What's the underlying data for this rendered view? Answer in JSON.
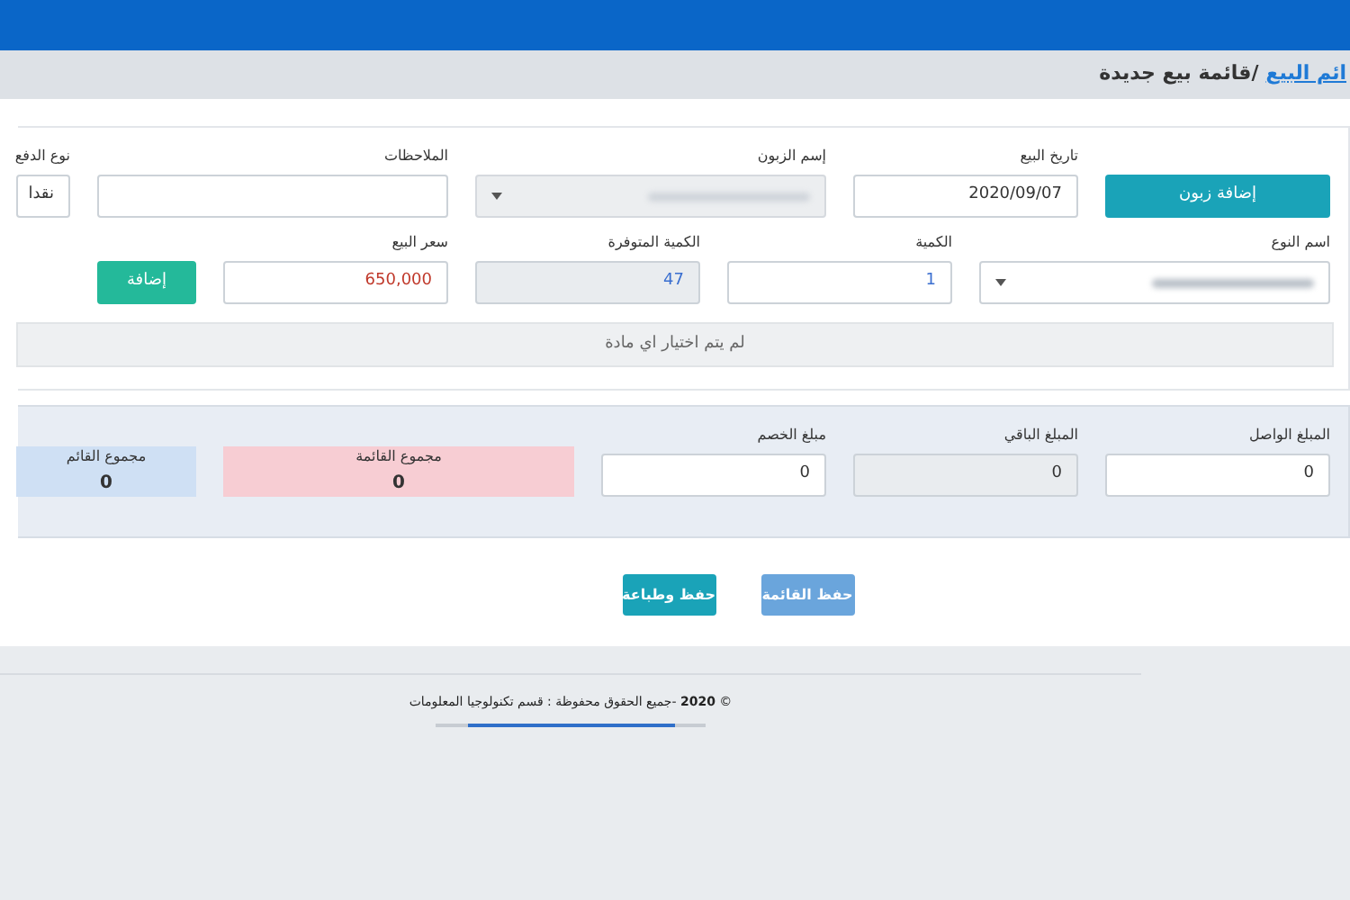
{
  "breadcrumb": {
    "link": "ائم البيع",
    "current": "/قائمة بيع جديدة"
  },
  "row_1": [
    {
      "kind": "button",
      "label": "إضافة زبون"
    },
    {
      "kind": "input",
      "label": "تاريخ البيع",
      "value": "2020/09/07"
    },
    {
      "kind": "select",
      "label": "إسم الزبون",
      "disabled": true
    },
    {
      "kind": "input",
      "label": "الملاحظات"
    },
    {
      "kind": "input",
      "label": "نوع الدفع",
      "value": "نقدا"
    }
  ],
  "row_2": [
    {
      "kind": "select",
      "label": "اسم النوع",
      "disabled": false
    },
    {
      "kind": "input",
      "label": "الكمية",
      "value": "1",
      "color": "#3b6fd0"
    },
    {
      "kind": "readonly",
      "label": "الكمية المتوفرة",
      "value": "47",
      "color": "#3b6fd0"
    },
    {
      "kind": "input",
      "label": "سعر البيع",
      "value": "650,000",
      "color": "#c0392b"
    },
    {
      "kind": "button",
      "label": "إضافة"
    }
  ],
  "notice": "لم يتم اختيار اي مادة",
  "summary": [
    {
      "kind": "input",
      "label": "المبلغ الواصل",
      "value": "0"
    },
    {
      "kind": "readonly",
      "label": "المبلغ الباقي",
      "value": "0"
    },
    {
      "kind": "input",
      "label": "مبلغ الخصم",
      "value": "0"
    },
    {
      "kind": "total",
      "label": "مجموع القائمة",
      "value": "0"
    },
    {
      "kind": "total",
      "label": "مجموع القائم",
      "value": "0"
    }
  ],
  "actions": [
    {
      "label": "حفظ القائمة"
    },
    {
      "label": "حفظ وطباعة"
    }
  ],
  "footer": "© **2020** -جميع الحقوق محفوظة : قسم تكنولوجيا المعلومات"
}
